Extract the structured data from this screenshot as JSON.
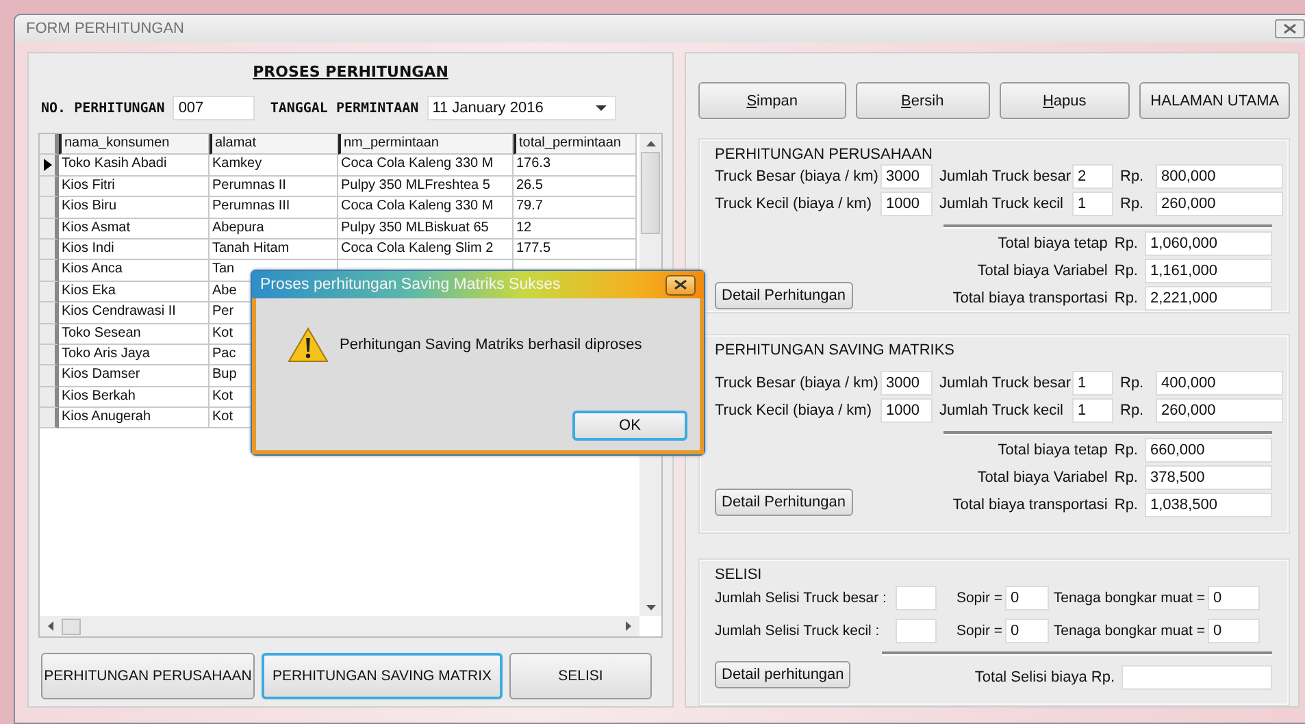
{
  "window": {
    "title": "FORM PERHITUNGAN"
  },
  "left": {
    "heading": "PROSES PERHITUNGAN",
    "fields": [
      {
        "kind": "text",
        "label": "NO. PERHITUNGAN",
        "value": "007"
      },
      {
        "kind": "dropdown",
        "label": "TANGGAL PERMINTAAN",
        "value": "11 January 2016"
      }
    ],
    "table": {
      "columns": [
        "nama_konsumen",
        "alamat",
        "nm_permintaan",
        "total_permintaan"
      ],
      "rows": [
        {
          "current": true,
          "cells": [
            "Toko Kasih Abadi",
            "Kamkey",
            "Coca Cola Kaleng 330 M",
            "176.3"
          ]
        },
        {
          "current": false,
          "cells": [
            "Kios Fitri",
            "Perumnas II",
            "Pulpy 350 MLFreshtea  5",
            "26.5"
          ]
        },
        {
          "current": false,
          "cells": [
            "Kios Biru",
            "Perumnas III",
            "Coca Cola Kaleng 330 M",
            "79.7"
          ]
        },
        {
          "current": false,
          "cells": [
            "Kios Asmat",
            "Abepura",
            "Pulpy 350 MLBiskuat 65",
            "12"
          ]
        },
        {
          "current": false,
          "cells": [
            "Kios Indi",
            "Tanah Hitam",
            "Coca Cola Kaleng Slim 2",
            "177.5"
          ]
        },
        {
          "current": false,
          "cells": [
            "Kios Anca",
            "Tan"
          ]
        },
        {
          "current": false,
          "cells": [
            "Kios Eka",
            "Abe"
          ]
        },
        {
          "current": false,
          "cells": [
            "Kios Cendrawasi II",
            "Per"
          ]
        },
        {
          "current": false,
          "cells": [
            "Toko Sesean",
            "Kot"
          ]
        },
        {
          "current": false,
          "cells": [
            "Toko Aris Jaya",
            "Pac"
          ]
        },
        {
          "current": false,
          "cells": [
            "Kios Damser",
            "Bup"
          ]
        },
        {
          "current": false,
          "cells": [
            "Kios Berkah",
            "Kot"
          ]
        },
        {
          "current": false,
          "cells": [
            "Kios Anugerah",
            "Kot"
          ]
        }
      ]
    },
    "buttons": [
      {
        "label": "PERHITUNGAN PERUSAHAAN",
        "focused": false
      },
      {
        "label": "PERHITUNGAN SAVING MATRIX",
        "focused": true
      },
      {
        "label": "SELISI",
        "focused": false
      }
    ]
  },
  "right": {
    "buttons": [
      {
        "label": "Simpan",
        "access_key": true
      },
      {
        "label": "Bersih",
        "access_key": true
      },
      {
        "label": "Hapus",
        "access_key": true
      },
      {
        "label": "HALAMAN UTAMA",
        "access_key": false
      }
    ],
    "groups": [
      {
        "kind": "cost",
        "title": "PERHITUNGAN PERUSAHAAN",
        "detail_button": "Detail Perhitungan",
        "rows": [
          {
            "label": "Truck Besar (biaya / km)",
            "value": "3000",
            "count_label": "Jumlah Truck besar",
            "count": "2",
            "currency": "Rp.",
            "amount": "800,000"
          },
          {
            "label": "Truck Kecil  (biaya / km)",
            "value": "1000",
            "count_label": "Jumlah Truck kecil",
            "count": "1",
            "currency": "Rp.",
            "amount": "260,000"
          }
        ],
        "totals": [
          {
            "label": "Total biaya tetap",
            "currency": "Rp.",
            "value": "1,060,000"
          },
          {
            "label": "Total biaya Variabel",
            "currency": "Rp.",
            "value": "1,161,000"
          },
          {
            "label": "Total biaya transportasi",
            "currency": "Rp.",
            "value": "2,221,000"
          }
        ]
      },
      {
        "kind": "cost",
        "title": "PERHITUNGAN SAVING MATRIKS",
        "detail_button": "Detail Perhitungan",
        "rows": [
          {
            "label": "Truck Besar (biaya / km)",
            "value": "3000",
            "count_label": "Jumlah Truck besar",
            "count": "1",
            "currency": "Rp.",
            "amount": "400,000"
          },
          {
            "label": "Truck Kecil (biaya / km)",
            "value": "1000",
            "count_label": "Jumlah Truck kecil",
            "count": "1",
            "currency": "Rp.",
            "amount": "260,000"
          }
        ],
        "totals": [
          {
            "label": "Total biaya tetap",
            "currency": "Rp.",
            "value": "660,000"
          },
          {
            "label": "Total biaya Variabel",
            "currency": "Rp.",
            "value": "378,500"
          },
          {
            "label": "Total biaya transportasi",
            "currency": "Rp.",
            "value": "1,038,500"
          }
        ]
      },
      {
        "kind": "difference",
        "title": "SELISI",
        "detail_button": "Detail perhitungan",
        "rows": [
          {
            "label": "Jumlah Selisi Truck besar :",
            "driver_label": "Sopir =",
            "driver": "0",
            "loader_label": "Tenaga bongkar muat =",
            "loader": "0"
          },
          {
            "label": "Jumlah Selisi Truck kecil :",
            "driver_label": "Sopir =",
            "driver": "0",
            "loader_label": "Tenaga bongkar muat =",
            "loader": "0"
          }
        ],
        "total": {
          "label": "Total Selisi biaya  Rp."
        }
      }
    ]
  },
  "dialog": {
    "title": "Proses perhitungan Saving Matriks Sukses",
    "message": "Perhitungan Saving Matriks berhasil diproses",
    "button": {
      "label": "OK",
      "default": true
    }
  }
}
